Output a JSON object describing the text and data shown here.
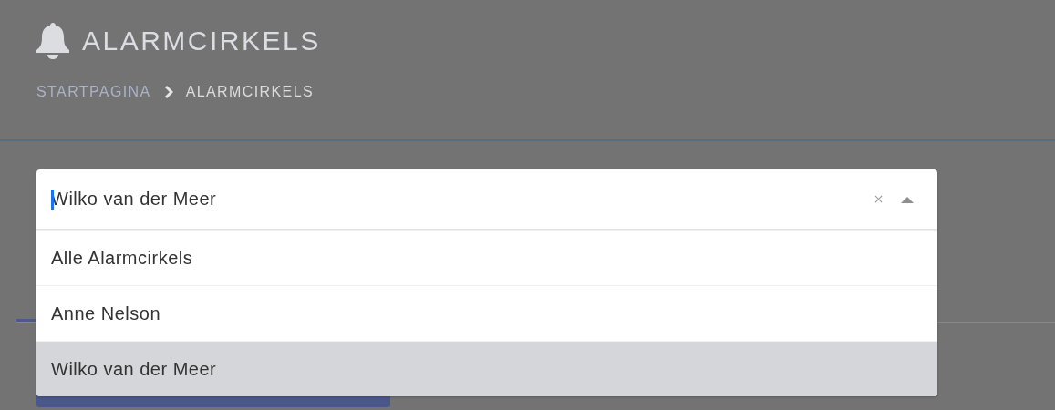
{
  "header": {
    "title": "ALARMCIRKELS"
  },
  "breadcrumb": [
    {
      "label": "STARTPAGINA",
      "kind": "link"
    },
    {
      "label": "ALARMCIRKELS",
      "kind": "current"
    }
  ],
  "select": {
    "value": "Wilko van der Meer",
    "expanded": true,
    "options": [
      {
        "label": "Alle Alarmcirkels",
        "selected": false
      },
      {
        "label": "Anne Nelson",
        "selected": false
      },
      {
        "label": "Wilko van der Meer",
        "selected": true
      }
    ]
  }
}
